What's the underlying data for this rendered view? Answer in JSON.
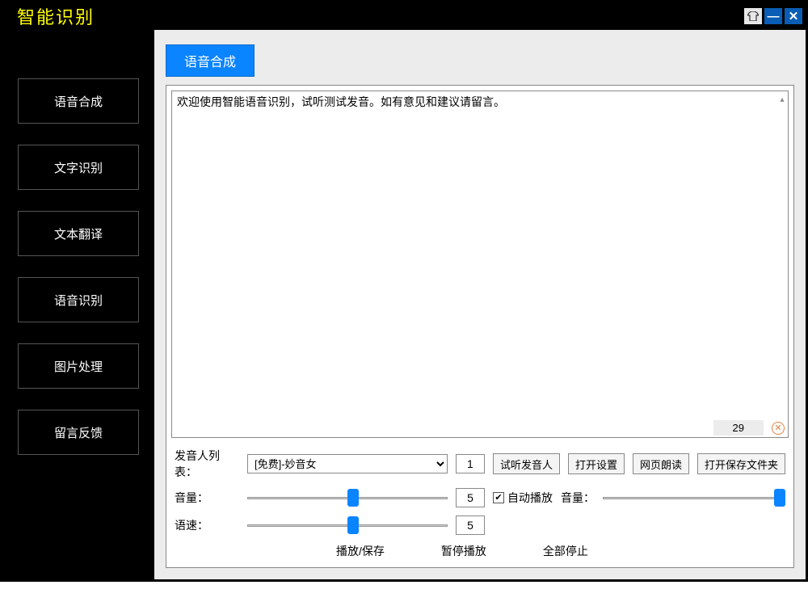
{
  "app": {
    "title": "智能识别"
  },
  "sidebar": {
    "items": [
      {
        "label": "语音合成"
      },
      {
        "label": "文字识别"
      },
      {
        "label": "文本翻译"
      },
      {
        "label": "语音识别"
      },
      {
        "label": "图片处理"
      },
      {
        "label": "留言反馈"
      }
    ]
  },
  "tab": {
    "label": "语音合成"
  },
  "editor": {
    "text": "欢迎使用智能语音识别，试听测试发音。如有意见和建议请留言。",
    "count": "29"
  },
  "voice": {
    "list_label": "发音人列表：",
    "selected": "[免费]-妙音女",
    "index": "1",
    "buttons": {
      "preview": "试听发音人",
      "open_settings": "打开设置",
      "web_read": "网页朗读",
      "open_folder": "打开保存文件夹"
    }
  },
  "volume": {
    "label": "音量：",
    "value": "5",
    "pos": 50
  },
  "speed": {
    "label": "语速：",
    "value": "5",
    "pos": 50
  },
  "autoplay": {
    "label": "自动播放",
    "checked": true
  },
  "master_volume": {
    "label": "音量：",
    "pos": 100
  },
  "actions": {
    "play_save": "播放/保存",
    "pause": "暂停播放",
    "stop_all": "全部停止"
  }
}
